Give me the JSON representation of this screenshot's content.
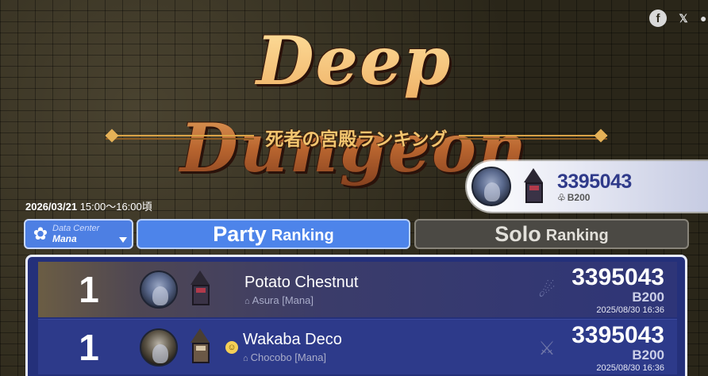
{
  "share": {
    "facebook": "f",
    "x": "𝕏",
    "more": "●"
  },
  "logo": {
    "title": "Deep Dungeon",
    "subtitle": "死者の宮殿ランキング"
  },
  "top_player": {
    "score": "3395043",
    "floor": "B200"
  },
  "datetime": {
    "date": "2026/03/21",
    "time": " 15:00～16:00頃"
  },
  "data_center": {
    "label": "Data Center",
    "value": "Mana"
  },
  "tabs": {
    "party": {
      "big": "Party",
      "small": "Ranking"
    },
    "solo": {
      "big": "Solo",
      "small": "Ranking"
    }
  },
  "rows": [
    {
      "rank": "1",
      "name": "Potato Chestnut",
      "world": "Asura [Mana]",
      "score": "3395043",
      "floor": "B200",
      "date": "2025/08/30 16:36",
      "job_icon": "dragoon-icon"
    },
    {
      "rank": "1",
      "name": "Wakaba Deco",
      "world": "Chocobo [Mana]",
      "score": "3395043",
      "floor": "B200",
      "date": "2025/08/30 16:36",
      "job_icon": "warrior-icon"
    }
  ],
  "colors": {
    "accent_blue": "#4d84ea",
    "table_bg": "#24307a",
    "score_blue": "#2f3a8a"
  }
}
